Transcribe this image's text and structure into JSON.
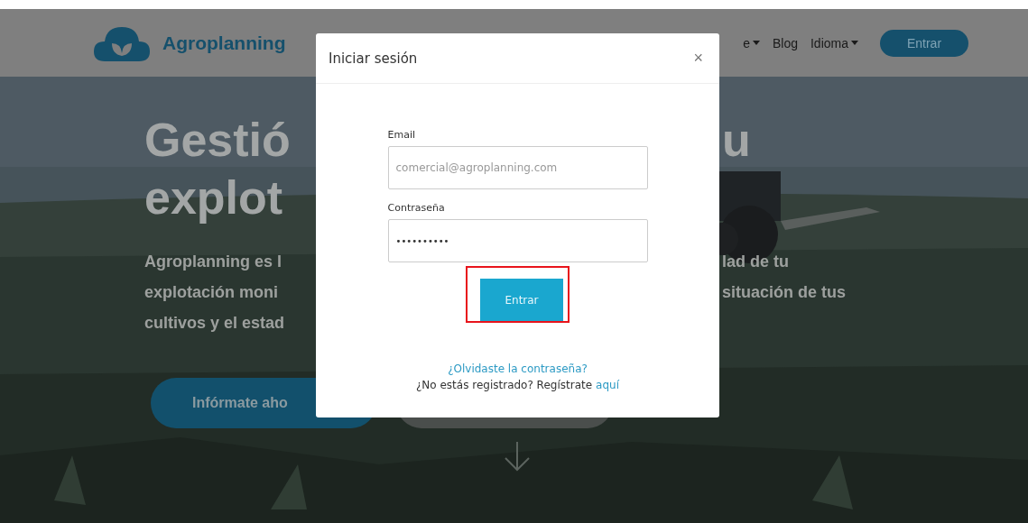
{
  "navbar": {
    "brand": "Agroplanning",
    "menu": [
      {
        "label": "e",
        "kind": "dropdown"
      },
      {
        "label": "Blog",
        "kind": "link"
      },
      {
        "label": "Idioma",
        "kind": "dropdown"
      }
    ],
    "login_button": "Entrar"
  },
  "hero": {
    "headline": [
      {
        "left": "Gestió",
        "right": "u"
      },
      {
        "left": "explot"
      }
    ],
    "text": [
      {
        "left": "Agroplanning es l",
        "right": "lad de tu"
      },
      {
        "left": "explotación moni",
        "right": "situación de tus"
      },
      {
        "left": "cultivos y el estad"
      }
    ],
    "buttons": [
      {
        "kind": "primary",
        "label": "Infórmate aho"
      },
      {
        "kind": "secondary"
      }
    ]
  },
  "modal": {
    "title": "Iniciar sesión",
    "close": "×",
    "fields": [
      {
        "label": "Email",
        "value": "comercial@agroplanning.com",
        "kind": "text"
      },
      {
        "label": "Contraseña",
        "value": "••••••••••",
        "kind": "password"
      }
    ],
    "submit": {
      "label": "Entrar",
      "highlighted": true
    },
    "forgot_link": "¿Olvidaste la contraseña?",
    "register_text": "¿No estás registrado? Regístrate",
    "register_link": "aquí"
  }
}
